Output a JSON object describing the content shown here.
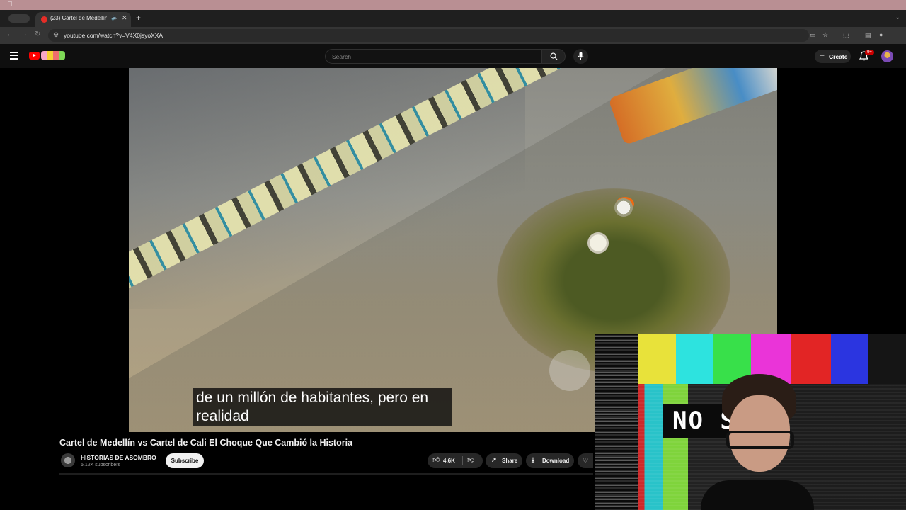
{
  "browser": {
    "tab_title": "(23) Cartel de Medellín vs",
    "url": "youtube.com/watch?v=V4X0jsyoXXA"
  },
  "youtube": {
    "search_placeholder": "Search",
    "create_label": "Create",
    "notification_count": "9+"
  },
  "video": {
    "subtitle": "de un millón de habitantes, pero en realidad",
    "title": "Cartel de Medellín vs Cartel de Cali El Choque Que Cambió la Historia",
    "channel_name": "HISTORIAS DE ASOMBRO",
    "subscribers": "5.12K subscribers",
    "subscribe_label": "Subscribe",
    "likes": "4.6K",
    "share_label": "Share",
    "download_label": "Download"
  },
  "webcam": {
    "overlay_text": "NO S      L"
  },
  "icons": {
    "apple": "apple-icon",
    "search": "search-icon",
    "mic": "mic-icon",
    "bell": "bell-icon",
    "like": "thumbs-up-icon",
    "dislike": "thumbs-down-icon",
    "share": "share-icon",
    "download": "download-icon"
  },
  "colors": {
    "youtube_red": "#ff0000",
    "background": "#0f0f0f",
    "pill": "#272727"
  }
}
